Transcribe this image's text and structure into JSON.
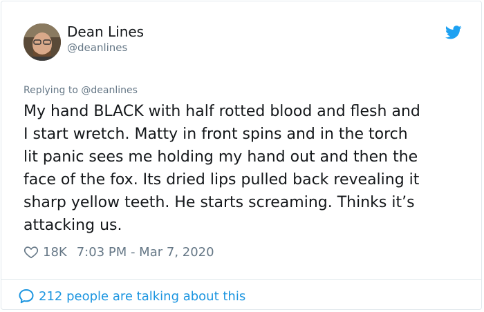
{
  "user": {
    "name": "Dean Lines",
    "handle": "@deanlines"
  },
  "reply": {
    "prefix": "Replying to",
    "mention": "@deanlines"
  },
  "tweet": {
    "text": "My hand BLACK with half rotted blood and flesh and\nI start wretch. Matty in front spins and in the torch\nlit panic sees me holding my hand out and then the\nface of the fox. Its dried lips pulled back revealing it\nsharp yellow teeth. He starts screaming. Thinks it’s\nattacking us.",
    "likes": "18K",
    "timestamp": "7:03 PM - Mar 7, 2020"
  },
  "footer": {
    "talking": "212 people are talking about this"
  },
  "colors": {
    "accent": "#1da1f2",
    "link": "#1b95e0",
    "muted": "#657786",
    "text": "#14171a"
  },
  "icons": [
    "avatar",
    "twitter-bird-icon",
    "heart-icon",
    "comment-bubble-icon"
  ]
}
